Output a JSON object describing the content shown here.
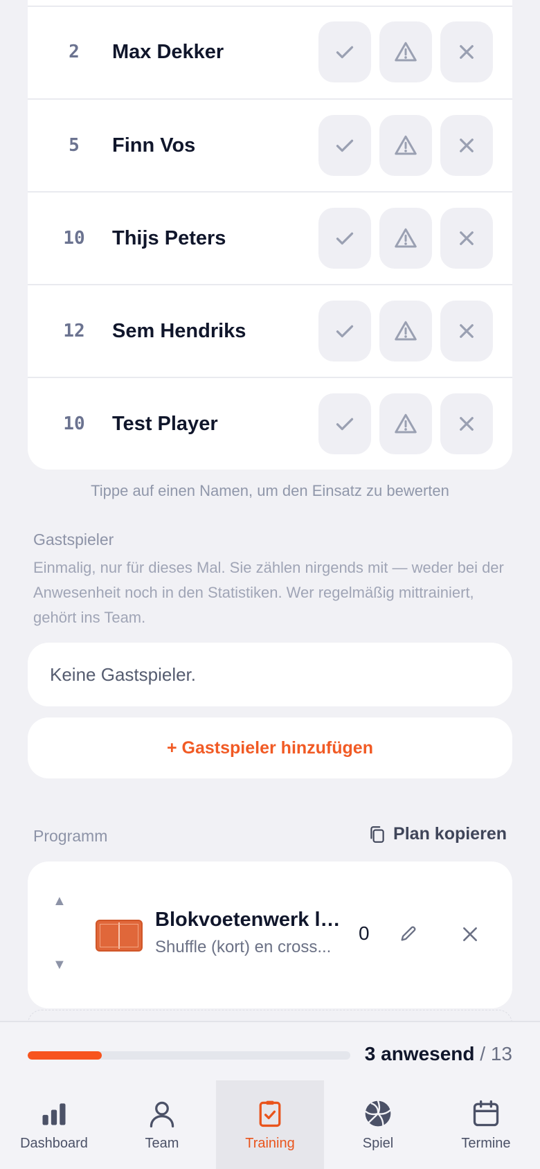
{
  "players": [
    {
      "number": "2",
      "name": "Max Dekker"
    },
    {
      "number": "5",
      "name": "Finn Vos"
    },
    {
      "number": "10",
      "name": "Thijs Peters"
    },
    {
      "number": "12",
      "name": "Sem Hendriks"
    },
    {
      "number": "10",
      "name": "Test Player"
    }
  ],
  "hint": "Tippe auf einen Namen, um den Einsatz zu bewerten",
  "guests": {
    "label": "Gastspieler",
    "description": "Einmalig, nur für dieses Mal. Sie zählen nirgends mit — weder bei der Anwesenheit noch in den Statistiken. Wer regelmäßig mittrainiert, gehört ins Team.",
    "empty_text": "Keine Gastspieler.",
    "add_label": "+ Gastspieler hinzufügen"
  },
  "program": {
    "label": "Programm",
    "copy_label": "Plan kopieren",
    "drills": [
      {
        "title": "Blokvoetenwerk la...",
        "subtitle": "Shuffle (kort) en cross...",
        "count": "0"
      }
    ]
  },
  "attendance": {
    "present_label": "3 anwesend",
    "total_label": "/ 13",
    "progress_fraction": 0.23
  },
  "nav": {
    "items": [
      {
        "label": "Dashboard",
        "icon": "bar-chart-icon"
      },
      {
        "label": "Team",
        "icon": "person-icon"
      },
      {
        "label": "Training",
        "icon": "clipboard-check-icon"
      },
      {
        "label": "Spiel",
        "icon": "volleyball-icon"
      },
      {
        "label": "Termine",
        "icon": "calendar-icon"
      }
    ],
    "active": "Training"
  },
  "colors": {
    "accent": "#f15a24",
    "icon_gray": "#9aa0b2"
  }
}
